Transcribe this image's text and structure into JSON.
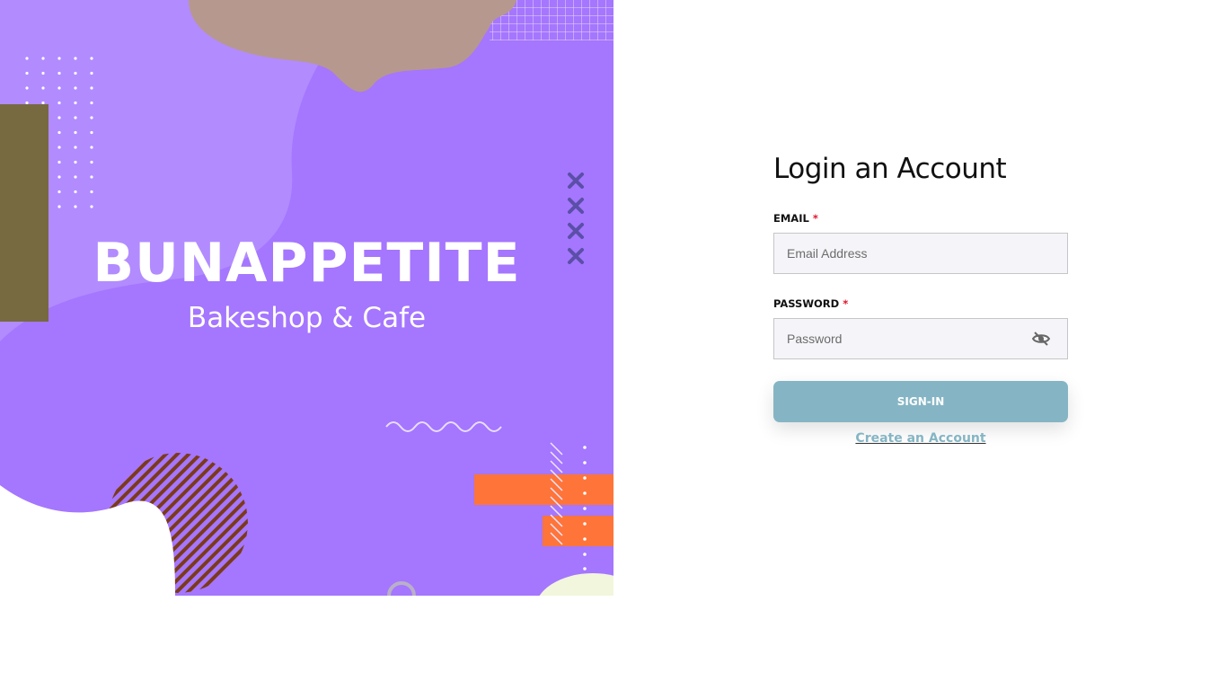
{
  "brand": {
    "title": "BUNAPPETITE",
    "subtitle": "Bakeshop & Cafe"
  },
  "login": {
    "heading": "Login an Account",
    "email_label": "EMAIL",
    "email_placeholder": "Email Address",
    "password_label": "PASSWORD",
    "password_placeholder": "Password",
    "required_mark": "*",
    "signin_label": "SIGN-IN",
    "create_account_label": "Create an Account"
  },
  "colors": {
    "hero_bg": "#a576fe",
    "button": "#85b5c4",
    "required": "#e0142a",
    "accent_orange": "#ff7439"
  }
}
